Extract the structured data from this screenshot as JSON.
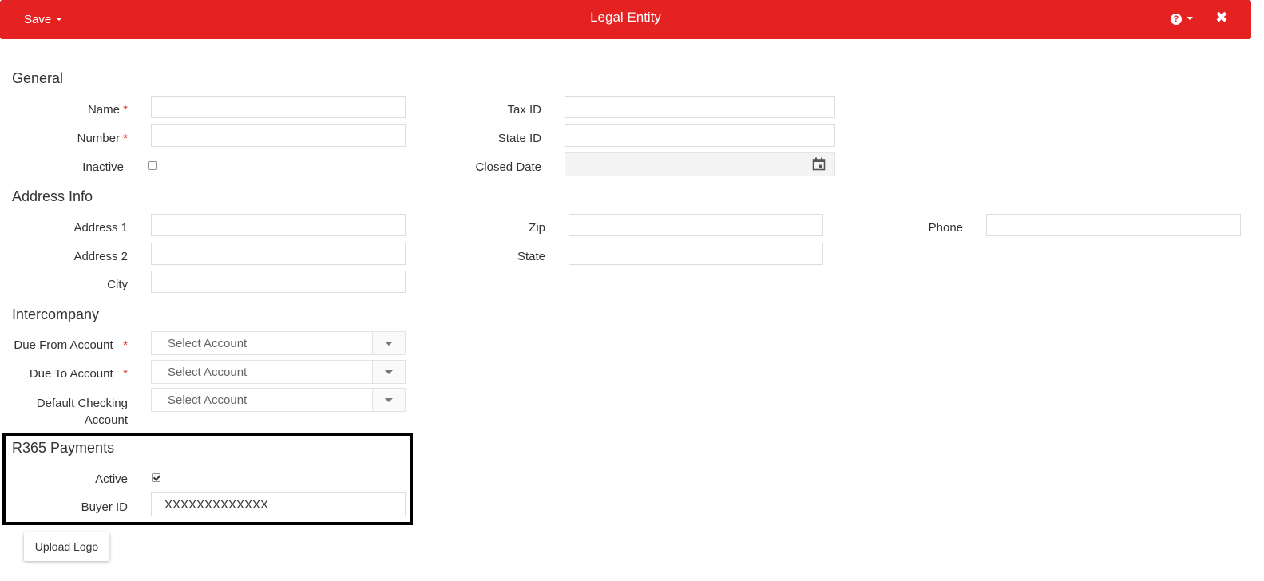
{
  "header": {
    "save_label": "Save",
    "title": "Legal Entity",
    "help_glyph": "?",
    "close_glyph": "✖",
    "bg_color": "#e52222"
  },
  "general": {
    "title": "General",
    "name_label": "Name",
    "number_label": "Number",
    "inactive_label": "Inactive",
    "tax_id_label": "Tax ID",
    "state_id_label": "State ID",
    "closed_date_label": "Closed Date",
    "required_mark": "*"
  },
  "address": {
    "title": "Address Info",
    "address1_label": "Address 1",
    "address2_label": "Address 2",
    "city_label": "City",
    "zip_label": "Zip",
    "state_label": "State",
    "phone_label": "Phone"
  },
  "intercompany": {
    "title": "Intercompany",
    "due_from_label": "Due From Account",
    "due_to_label": "Due To Account",
    "default_checking_line1": "Default Checking",
    "default_checking_line2": "Account",
    "select_placeholder": "Select Account"
  },
  "payments": {
    "title": "R365 Payments",
    "active_label": "Active",
    "buyer_id_label": "Buyer ID",
    "buyer_id_value": "XXXXXXXXXXXXX"
  },
  "upload_logo_label": "Upload Logo",
  "icons": {
    "save_caret": "chevron-down-icon",
    "help": "help-icon",
    "close": "close-icon",
    "calendar": "calendar-icon",
    "select_caret": "chevron-down-icon"
  }
}
